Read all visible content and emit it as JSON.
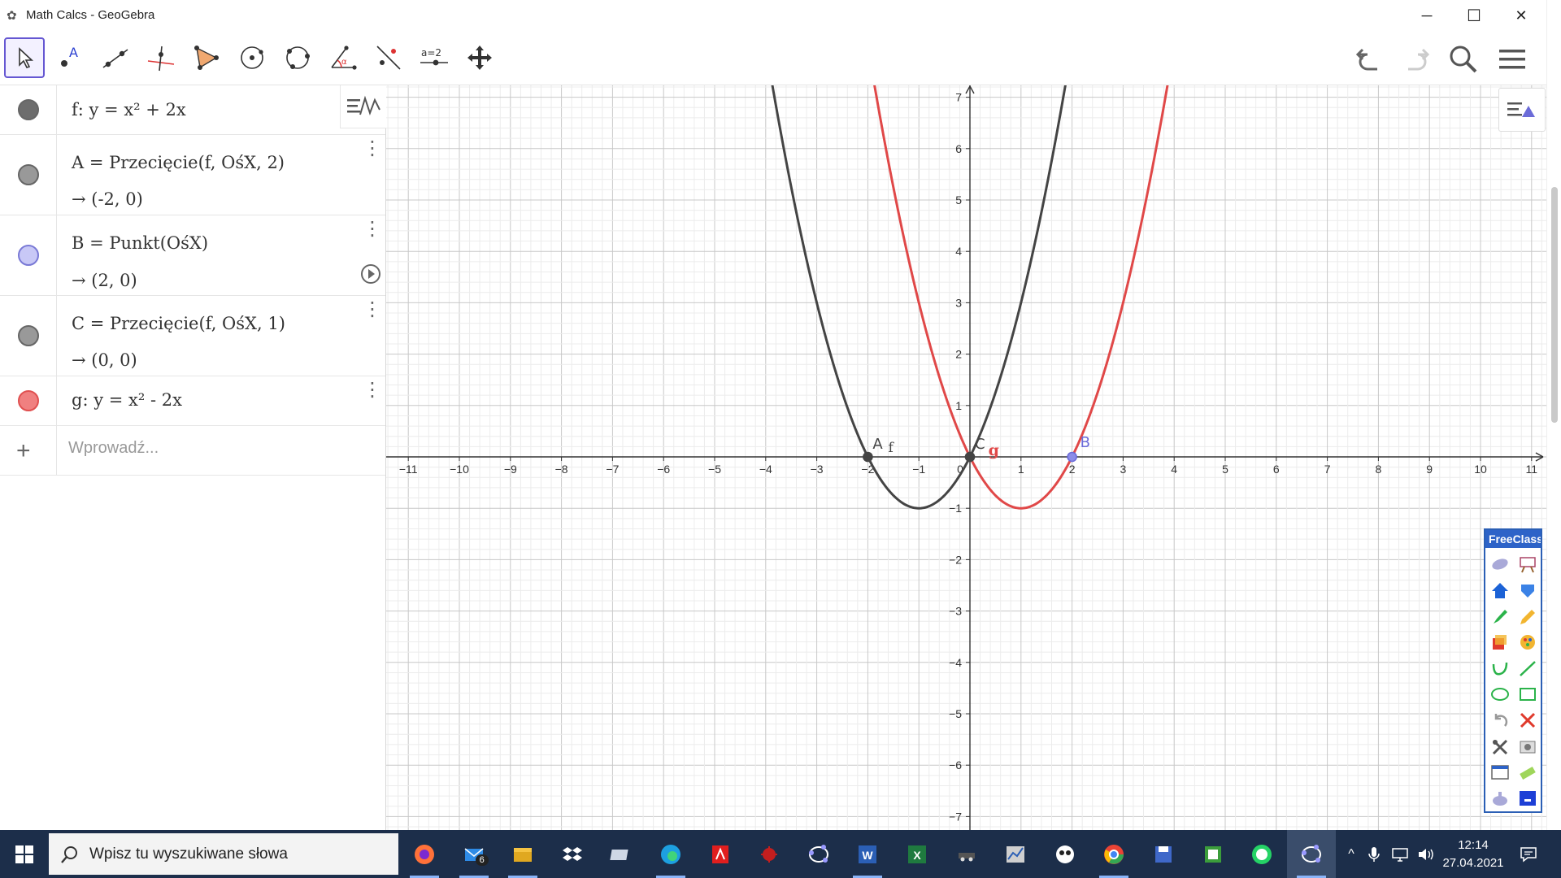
{
  "window": {
    "title": "Math Calcs - GeoGebra",
    "minimize": "─",
    "maximize": "☐",
    "close": "✕"
  },
  "toolbar": {
    "tools": [
      "move",
      "point",
      "line",
      "perpendicular-line",
      "polygon",
      "circle-center-point",
      "circle-three-points",
      "angle",
      "reflect",
      "slider",
      "move-graphics-view"
    ],
    "slider_label": "a=2"
  },
  "algebra": {
    "rows": [
      {
        "def": "f: y = x² + 2x",
        "value": "",
        "color": "#666666",
        "fill": "#6d6d6d"
      },
      {
        "def": "A = Przecięcie(f, OśX, 2)",
        "value": "→ (-2, 0)",
        "color": "#666666",
        "fill": "#999999"
      },
      {
        "def": "B = Punkt(OśX)",
        "value": "→ (2, 0)",
        "color": "#7a7ad6",
        "fill": "#c8c8f6"
      },
      {
        "def": "C = Przecięcie(f, OśX, 1)",
        "value": "→ (0, 0)",
        "color": "#666666",
        "fill": "#999999"
      },
      {
        "def": "g: y = x² - 2x",
        "value": "",
        "color": "#e05050",
        "fill": "#f08080"
      }
    ],
    "input_placeholder": "Wprowadź..."
  },
  "graphics": {
    "x_ticks": [
      "-11",
      "-10",
      "-9",
      "-8",
      "-7",
      "-6",
      "-5",
      "-4",
      "-3",
      "-2",
      "-1",
      "0",
      "1",
      "2",
      "3",
      "4",
      "5",
      "6",
      "7",
      "8",
      "9",
      "10",
      "11"
    ],
    "y_ticks": [
      "7",
      "6",
      "5",
      "4",
      "3",
      "2",
      "1",
      "-1",
      "-2",
      "-3",
      "-4",
      "-5",
      "-6",
      "-7"
    ],
    "x_range": [
      -11.5,
      11.5
    ],
    "y_range": [
      -7.3,
      7.3
    ],
    "curves": [
      {
        "name": "f",
        "expr": "x^2 + 2x",
        "color": "#444444"
      },
      {
        "name": "g",
        "expr": "x^2 - 2x",
        "color": "#e04848"
      }
    ],
    "points": [
      {
        "name": "A",
        "x": -2,
        "y": 0,
        "color": "#444444",
        "label": "A"
      },
      {
        "name": "B",
        "x": 2,
        "y": 0,
        "color": "#6b6bd8",
        "label": "B"
      },
      {
        "name": "C",
        "x": 0,
        "y": 0,
        "color": "#444444",
        "label": "C"
      }
    ],
    "curve_labels": {
      "f": "f",
      "g": "g"
    }
  },
  "freeclass": {
    "title": "FreeClass",
    "icons": [
      "eraser-icon",
      "presentation-icon",
      "home-icon",
      "layers-icon",
      "marker-icon",
      "pencil-icon",
      "paint-icon",
      "palette-icon",
      "curve-icon",
      "line-icon",
      "ellipse-icon",
      "rectangle-icon",
      "undo-icon",
      "delete-icon",
      "tools-icon",
      "camera-icon",
      "window-icon",
      "eraser-bar-icon",
      "hand-icon",
      "color-icon"
    ]
  },
  "taskbar": {
    "search_placeholder": "Wpisz tu wyszukiwane słowa",
    "apps": [
      "firefox",
      "mail",
      "file-explorer",
      "dropbox",
      "cloud-drive",
      "edge",
      "acrobat",
      "app-red",
      "geogebra-1",
      "word",
      "excel",
      "app-car",
      "app-chart",
      "panda",
      "chrome",
      "save-app",
      "excel-green",
      "whatsapp",
      "geogebra-active"
    ],
    "mail_badge": "6",
    "time": "12:14",
    "date": "27.04.2021"
  },
  "colors": {
    "accent": "#6557d2",
    "taskbar": "#1c2e4a",
    "curve_f": "#444444",
    "curve_g": "#e04848"
  }
}
